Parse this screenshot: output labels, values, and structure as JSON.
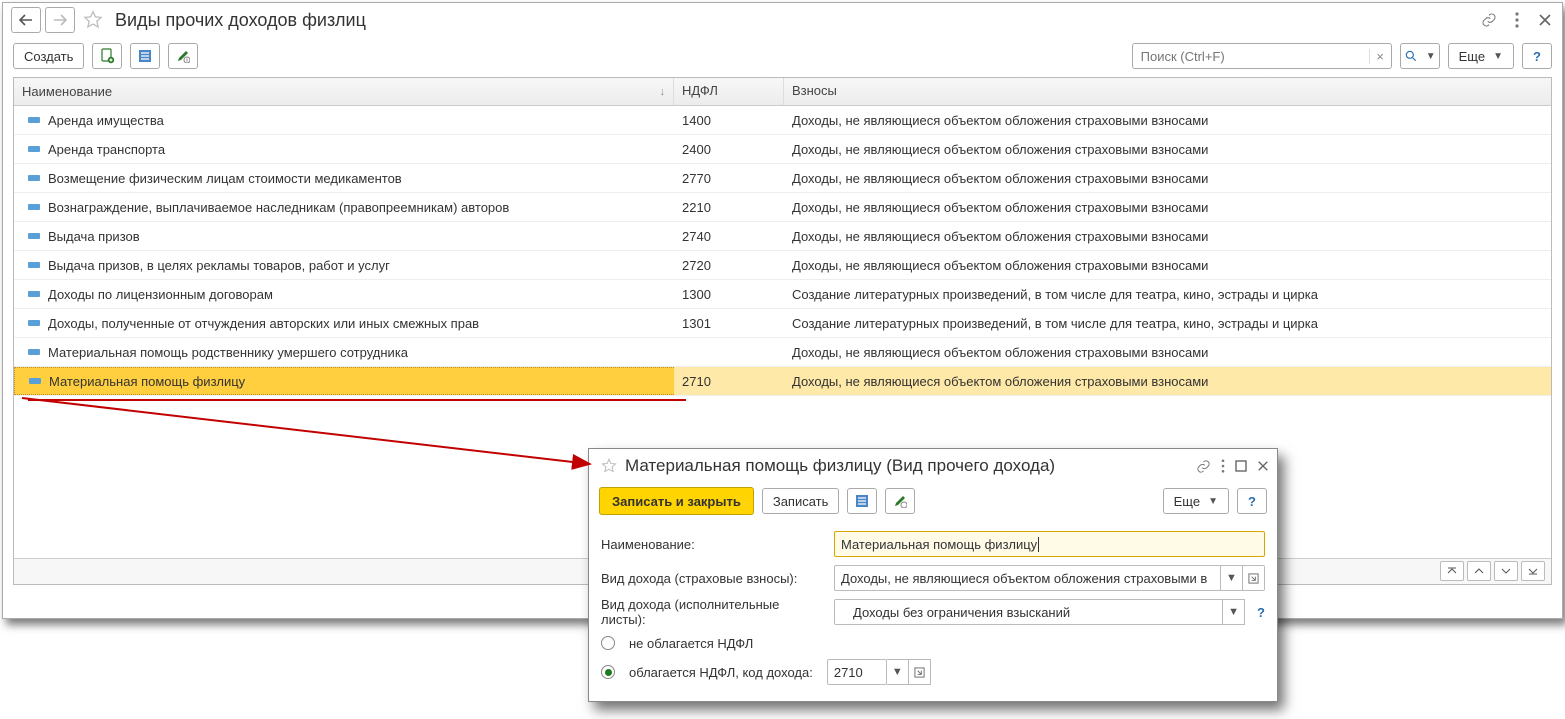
{
  "header": {
    "title": "Виды прочих доходов физлиц"
  },
  "toolbar": {
    "create": "Создать",
    "search_placeholder": "Поиск (Ctrl+F)",
    "more": "Еще"
  },
  "grid": {
    "columns": {
      "name": "Наименование",
      "ndfl": "НДФЛ",
      "vz": "Взносы"
    },
    "rows": [
      {
        "name": "Аренда имущества",
        "ndfl": "1400",
        "vz": "Доходы, не являющиеся объектом обложения страховыми взносами"
      },
      {
        "name": "Аренда транспорта",
        "ndfl": "2400",
        "vz": "Доходы, не являющиеся объектом обложения страховыми взносами"
      },
      {
        "name": "Возмещение физическим лицам стоимости медикаментов",
        "ndfl": "2770",
        "vz": "Доходы, не являющиеся объектом обложения страховыми взносами"
      },
      {
        "name": "Вознаграждение, выплачиваемое наследникам (правопреемникам) авторов",
        "ndfl": "2210",
        "vz": "Доходы, не являющиеся объектом обложения страховыми взносами"
      },
      {
        "name": "Выдача призов",
        "ndfl": "2740",
        "vz": "Доходы, не являющиеся объектом обложения страховыми взносами"
      },
      {
        "name": "Выдача призов, в целях рекламы товаров, работ и услуг",
        "ndfl": "2720",
        "vz": "Доходы, не являющиеся объектом обложения страховыми взносами"
      },
      {
        "name": "Доходы по лицензионным договорам",
        "ndfl": "1300",
        "vz": "Создание литературных произведений, в том числе для театра, кино, эстрады и цирка"
      },
      {
        "name": "Доходы, полученные от отчуждения авторских или иных смежных прав",
        "ndfl": "1301",
        "vz": "Создание литературных произведений, в том числе для театра, кино, эстрады и цирка"
      },
      {
        "name": "Материальная помощь родственнику умершего сотрудника",
        "ndfl": "",
        "vz": "Доходы, не являющиеся объектом обложения страховыми взносами"
      },
      {
        "name": "Материальная помощь физлицу",
        "ndfl": "2710",
        "vz": "Доходы, не являющиеся объектом обложения страховыми взносами"
      }
    ]
  },
  "dialog": {
    "title": "Материальная помощь физлицу (Вид прочего дохода)",
    "save_close": "Записать и закрыть",
    "save": "Записать",
    "more": "Еще",
    "fields": {
      "name_label": "Наименование:",
      "name_value": "Материальная помощь физлицу",
      "vz_label": "Вид дохода (страховые взносы):",
      "vz_value": "Доходы, не являющиеся объектом обложения страховыми в",
      "il_label": "Вид дохода (исполнительные листы):",
      "il_value": "Доходы без ограничения взысканий",
      "radio_no": "не облагается НДФЛ",
      "radio_yes": "облагается НДФЛ, код дохода:",
      "code": "2710"
    }
  }
}
